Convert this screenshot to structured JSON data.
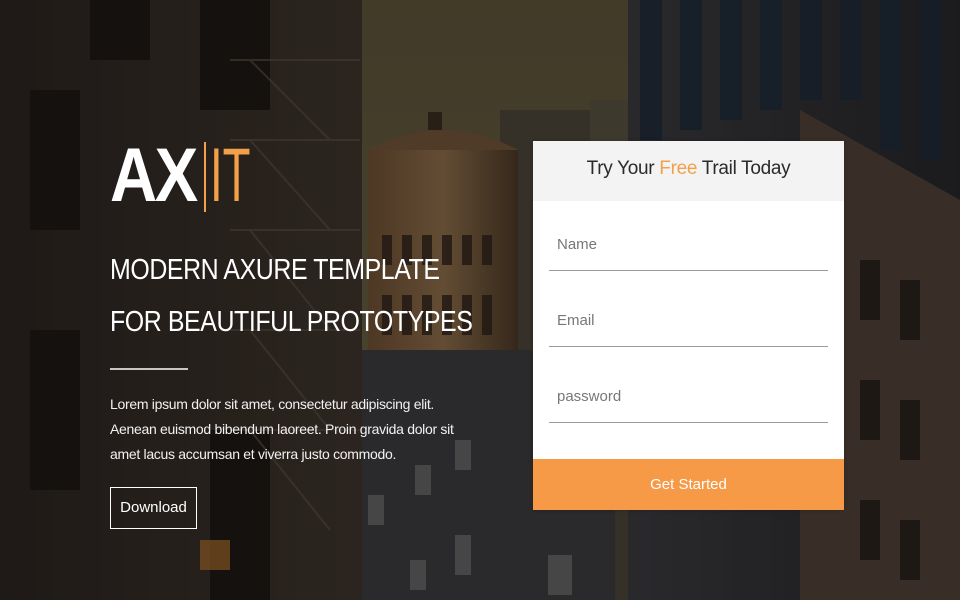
{
  "hero": {
    "logo_main": "AX",
    "logo_accent": "IT",
    "headline_line1": "MODERN AXURE TEMPLATE",
    "headline_line2": "FOR BEAUTIFUL PROTOTYPES",
    "body_text": "Lorem ipsum dolor sit amet, consectetur adipiscing elit. Aenean euismod bibendum laoreet. Proin gravida dolor sit amet lacus accumsan et viverra justo commodo.",
    "download_label": "Download"
  },
  "signup": {
    "title_prefix": "Try Your ",
    "title_accent": "Free",
    "title_suffix": " Trail Today",
    "name_placeholder": "Name",
    "email_placeholder": "Email",
    "password_placeholder": "password",
    "submit_label": "Get Started"
  },
  "colors": {
    "accent": "#f4a04a",
    "button": "#f69a47",
    "card_header_bg": "#f3f3f3"
  }
}
